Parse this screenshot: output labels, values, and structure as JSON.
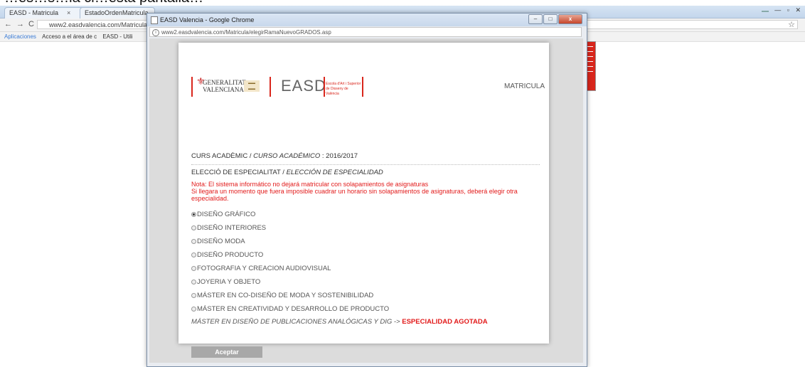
{
  "caption": "…es…s…la ci…esta pantalla…",
  "bg_browser": {
    "tabs": [
      {
        "label": "EASD - Matricula"
      },
      {
        "label": "EstadoOrdenMatricula"
      }
    ],
    "user_badge": "",
    "url": "www2.easdvalencia.com/Matricula/",
    "bookmarks": {
      "apps": "Aplicaciones",
      "link1": "Acceso a el área de c",
      "link2": "EASD - Utili"
    }
  },
  "popup": {
    "title": "EASD Valencia - Google Chrome",
    "url": "www2.easdvalencia.com/Matricula/elegirRamaNuevoGRADOS.asp",
    "header": {
      "gen_line1": "GENERALITAT",
      "gen_line2": "VALENCIANA",
      "easd": "EASD",
      "easd_sub": "Escola d'Art i Superior de Disseny de València",
      "matricula": "MATRICULA"
    },
    "curs": {
      "label": "CURS ACADÈMIC / ",
      "label_es": "CURSO ACADÉMICO",
      "value": " : 2016/2017"
    },
    "eleccio": {
      "label": "ELECCIÓ DE ESPECIALITAT / ",
      "label_es": "ELECCIÓN DE ESPECIALIDAD"
    },
    "note": {
      "line1": "Nota: El sistema informático no dejará matricular con solapamientos de asignaturas",
      "line2": "Si llegara un momento que fuera imposible cuadrar un horario sin solapamientos de asignaturas, deberá elegir otra especialidad."
    },
    "options": [
      {
        "label": "DISEÑO GRÁFICO",
        "selected": true
      },
      {
        "label": "DISEÑO INTERIORES",
        "selected": false
      },
      {
        "label": "DISEÑO MODA",
        "selected": false
      },
      {
        "label": "DISEÑO PRODUCTO",
        "selected": false
      },
      {
        "label": "FOTOGRAFIA Y CREACION AUDIOVISUAL",
        "selected": false
      },
      {
        "label": "JOYERIA Y OBJETO",
        "selected": false
      },
      {
        "label": "MÁSTER EN CO-DISEÑO DE MODA Y SOSTENIBILIDAD",
        "selected": false
      },
      {
        "label": "MÁSTER EN CREATIVIDAD Y DESARROLLO DE PRODUCTO",
        "selected": false
      }
    ],
    "agotada": {
      "label": "MÁSTER EN DISEÑO DE PUBLICACIONES ANALÓGICAS Y DIG -> ",
      "status": "ESPECIALIDAD AGOTADA"
    },
    "button": "Aceptar"
  },
  "colors": {
    "accent_red": "#d9261c",
    "warning_red": "#e21a1a",
    "button_gray": "#a8a8a8"
  }
}
